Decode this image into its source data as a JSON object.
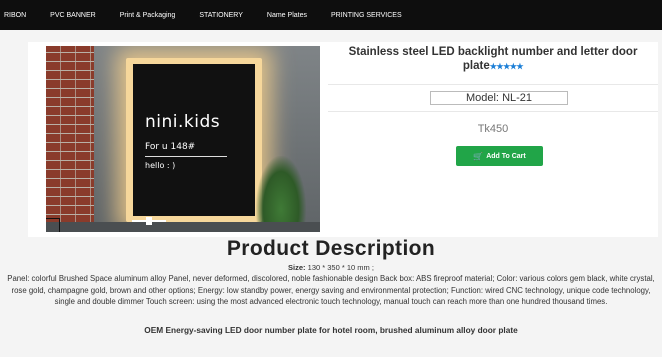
{
  "nav": {
    "items": [
      "RIBON",
      "PVC BANNER",
      "Print & Packaging",
      "STATIONERY",
      "Name Plates",
      "PRINTING SERVICES"
    ]
  },
  "product_image": {
    "plate_text_1": "nini.kids",
    "plate_text_2": "For u 148#",
    "plate_text_3": "hello : )"
  },
  "product": {
    "title": "Stainless steel LED backlight number and letter door plate",
    "stars": "★★★★★",
    "model_label": "Model:",
    "model_value": "NL-21",
    "price": "Tk450",
    "add_to_cart_label": "Add To Cart",
    "cart_icon": "🛒"
  },
  "description": {
    "heading": "Product Description",
    "size_label": "Size:",
    "size_value": "130 * 350 * 10 mm ;",
    "body": "Panel: colorful  Brushed Space aluminum alloy  Panel, never deformed, discolored, noble fashionable design  Back box: ABS fireproof material; Color: various colors gem black, white crystal, rose gold, champagne gold, brown and other options; Energy: low standby power, energy saving and environmental protection; Function: wired CNC technology, unique code technology, single and double dimmer Touch screen: using the most advanced electronic touch technology, manual touch can reach more than one hundred thousand times.",
    "highlight": "OEM Energy-saving LED door number plate for hotel room, brushed aluminum alloy door plate"
  },
  "colors": {
    "nav_bg": "#0e0e0e",
    "button_green": "#21a548",
    "star_blue": "#1a7ed6"
  }
}
